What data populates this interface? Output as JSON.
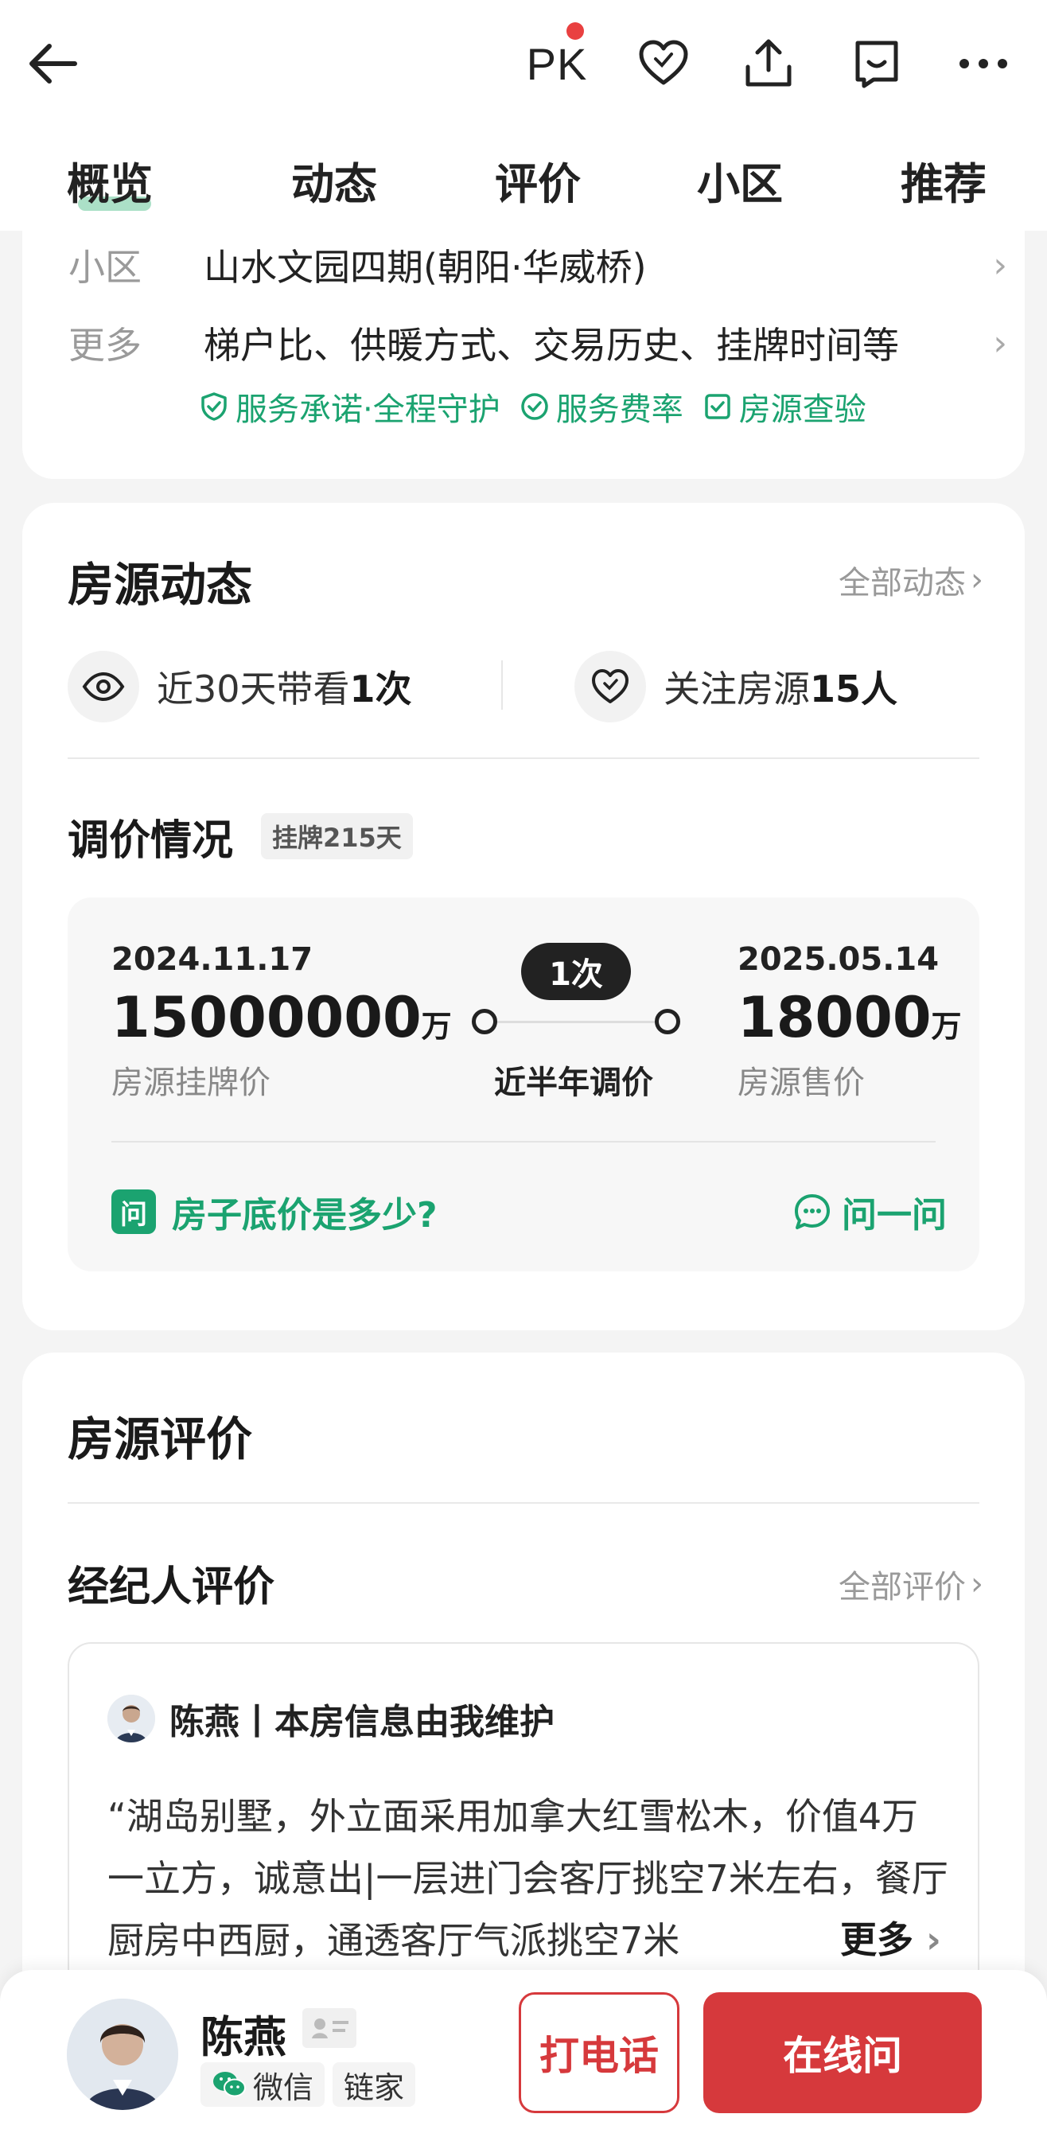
{
  "header": {
    "pk_label": "PK",
    "tabs": [
      "概览",
      "动态",
      "评价",
      "小区",
      "推荐"
    ]
  },
  "info": {
    "rows": [
      {
        "label": "小区",
        "value": "山水文园四期(朝阳·华威桥)"
      },
      {
        "label": "更多",
        "value": "梯户比、供暖方式、交易历史、挂牌时间等"
      }
    ],
    "services": [
      "服务承诺·全程守护",
      "服务费率",
      "房源查验"
    ]
  },
  "dynamics": {
    "title": "房源动态",
    "more_label": "全部动态",
    "visits_prefix": "近30天带看",
    "visits_value": "1次",
    "follow_prefix": "关注房源",
    "follow_value": "15人"
  },
  "price_adjust": {
    "title": "调价情况",
    "badge": "挂牌215天",
    "start_date": "2024.11.17",
    "start_price": "15000000",
    "start_unit": "万",
    "start_caption": "房源挂牌价",
    "count_pill": "1次",
    "mid_caption": "近半年调价",
    "end_date": "2025.05.14",
    "end_price": "18000",
    "end_unit": "万",
    "end_caption": "房源售价",
    "ask_icon": "问",
    "ask_question": "房子底价是多少?",
    "ask_action": "问一问"
  },
  "review": {
    "title": "房源评价",
    "sub_title": "经纪人评价",
    "more_label": "全部评价",
    "agent_line": "陈燕丨本房信息由我维护",
    "text": "“湖岛别墅，外立面采用加拿大红雪松木，价值4万一立方，诚意出|一层进门会客厅挑空7米左右，餐厅厨房中西厨，通透客厅气派挑空7米",
    "more": "更多"
  },
  "bottom": {
    "agent_name": "陈燕",
    "tag_wechat": "微信",
    "tag_company": "链家",
    "call_label": "打电话",
    "online_label": "在线问"
  },
  "colors": {
    "accent_green": "#1ba370",
    "accent_red": "#d6393c",
    "pk_dot": "#e94040"
  }
}
